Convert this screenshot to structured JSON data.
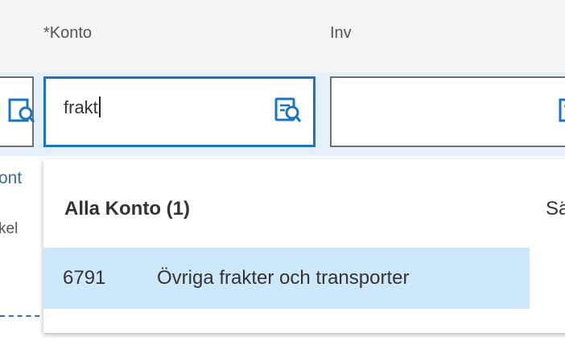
{
  "columns": {
    "konto_label": "*Konto",
    "inv_label": "Inv"
  },
  "konto_field": {
    "value": "frakt"
  },
  "background_partial": {
    "link_text": "ont",
    "sub_text": "kel"
  },
  "dropdown": {
    "header": "Alla Konto (1)",
    "second_column_header": "Sä",
    "items": [
      {
        "code": "6791",
        "name": "Övriga frakter och transporter"
      }
    ]
  },
  "colors": {
    "focus_border": "#1b75bb",
    "selected_row": "#cde7fb",
    "icon": "#1b75bb"
  }
}
